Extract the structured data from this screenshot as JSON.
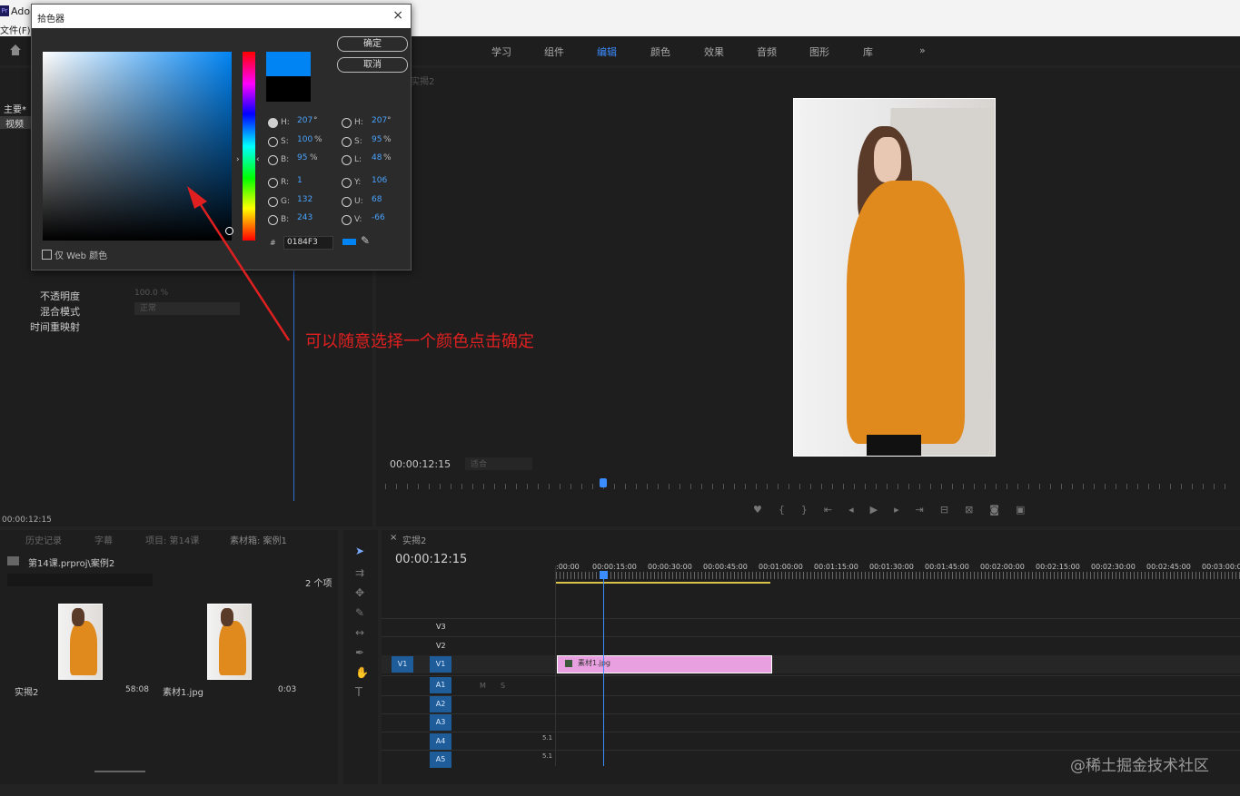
{
  "app": {
    "logo": "Pr",
    "name": "Ado",
    "menu_file": "文件(F)"
  },
  "workspace_tabs": [
    {
      "label": "学习"
    },
    {
      "label": "组件"
    },
    {
      "label": "编辑"
    },
    {
      "label": "颜色"
    },
    {
      "label": "效果"
    },
    {
      "label": "音频"
    },
    {
      "label": "图形"
    },
    {
      "label": "库"
    }
  ],
  "workspace_more": "»",
  "active_workspace": "编辑",
  "effects_panel": {
    "tab_main": "主要*",
    "tab_video": "视频",
    "opacity_label": "不透明度",
    "opacity_value": "100.0 %",
    "blend_label": "混合模式",
    "blend_value": "正常",
    "time_remap_label": "时间重映射",
    "timecode": "00:00:12:15"
  },
  "color_picker": {
    "title": "拾色器",
    "close": "×",
    "ok": "确定",
    "cancel": "取消",
    "web_only": "仅 Web 颜色",
    "new_color": "#0184f3",
    "old_color": "#000000",
    "hsb": [
      {
        "label": "H:",
        "value": "207",
        "unit": "°"
      },
      {
        "label": "S:",
        "value": "100",
        "unit": "%"
      },
      {
        "label": "B:",
        "value": "95",
        "unit": "%"
      }
    ],
    "rgb": [
      {
        "label": "R:",
        "value": "1"
      },
      {
        "label": "G:",
        "value": "132"
      },
      {
        "label": "B:",
        "value": "243"
      }
    ],
    "hsl": [
      {
        "label": "H:",
        "value": "207",
        "unit": "°"
      },
      {
        "label": "S:",
        "value": "95",
        "unit": "%"
      },
      {
        "label": "L:",
        "value": "48",
        "unit": "%"
      }
    ],
    "yuv": [
      {
        "label": "Y:",
        "value": "106"
      },
      {
        "label": "U:",
        "value": "68"
      },
      {
        "label": "V:",
        "value": "-66"
      }
    ],
    "hash": "#",
    "hex": "0184F3"
  },
  "annotation": "可以随意选择一个颜色点击确定",
  "program_monitor": {
    "tab": "实揭2",
    "timecode": "00:00:12:15",
    "fit": "适合"
  },
  "project_panel": {
    "tabs": [
      "历史记录",
      "字幕",
      "项目: 第14课",
      "素材箱: 案例1"
    ],
    "path": "第14课.prproj\\案例2",
    "count": "2 个项",
    "items": [
      {
        "name": "实揭2",
        "duration": "58:08"
      },
      {
        "name": "素材1.jpg",
        "duration": "0:03"
      }
    ]
  },
  "timeline": {
    "tab": "实揭2",
    "timecode": "00:00:12:15",
    "ruler": [
      ":00:00",
      "00:00:15:00",
      "00:00:30:00",
      "00:00:45:00",
      "00:01:00:00",
      "00:01:15:00",
      "00:01:30:00",
      "00:01:45:00",
      "00:02:00:00",
      "00:02:15:00",
      "00:02:30:00",
      "00:02:45:00",
      "00:03:00:00"
    ],
    "video_tracks": [
      "V3",
      "V2",
      "V1"
    ],
    "source_patch": "V1",
    "audio_tracks": [
      "A1",
      "A2",
      "A3",
      "A4",
      "A5"
    ],
    "mute": "M",
    "solo": "S",
    "channel_51": "5.1",
    "clip_name": "素材1.jpg"
  },
  "watermark": "@稀土掘金技术社区"
}
